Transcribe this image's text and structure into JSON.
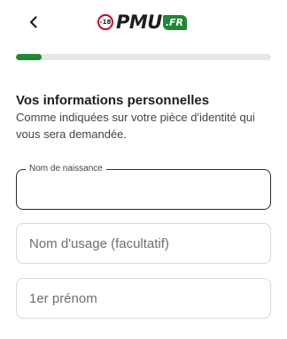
{
  "header": {
    "back_icon": "chevron-left-icon",
    "logo": {
      "age": "-18",
      "brand": "PMU",
      "tld": ".FR",
      "accent": "#1a8a33"
    }
  },
  "progress": {
    "value": 0.1,
    "color": "#1a8a33"
  },
  "section": {
    "title": "Vos informations personnelles",
    "description": "Comme indiquées sur votre pièce d'identité qui vous sera demandée."
  },
  "fields": {
    "birth_name": {
      "label": "Nom de naissance",
      "value": ""
    },
    "usage_name": {
      "placeholder": "Nom d'usage (facultatif)",
      "value": ""
    },
    "first_name": {
      "placeholder": "1er prénom",
      "value": ""
    }
  }
}
